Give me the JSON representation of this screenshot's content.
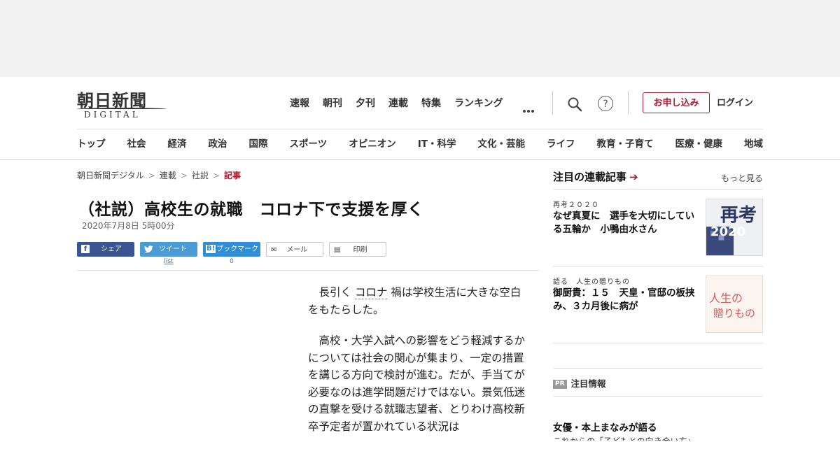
{
  "logo": {
    "name_jp": "朝日新聞",
    "name_en": "DIGITAL"
  },
  "topnav": [
    "速報",
    "朝刊",
    "夕刊",
    "連載",
    "特集",
    "ランキング"
  ],
  "header": {
    "apply_label": "お申し込み",
    "login_label": "ログイン",
    "help_glyph": "?"
  },
  "categories": [
    "トップ",
    "社会",
    "経済",
    "政治",
    "国際",
    "スポーツ",
    "オピニオン",
    "IT・科学",
    "文化・芸能",
    "ライフ",
    "教育・子育て",
    "医療・健康",
    "地域"
  ],
  "breadcrumb": [
    "朝日新聞デジタル",
    "連載",
    "社説",
    "記事"
  ],
  "article": {
    "headline": "（社説）高校生の就職　コロナ下で支援を厚く",
    "date": "2020年7月8日 5時00分",
    "p1_before": "長引く",
    "p1_keyword": "コロナ",
    "p1_after": "禍は学校生活に大きな空白をもたらした。",
    "p2": "高校・大学入試への影響をどう軽減するかについては社会の関心が集まり、一定の措置を講じる方向で検討が進む。だが、手当てが必要なのは進学問題だけではない。景気低迷の直撃を受ける就職志望者、とりわけ高校新卒予定者が置かれている状況は"
  },
  "share": {
    "facebook": "シェア",
    "twitter": "ツイート",
    "hatena": "ブックマーク",
    "mail": "メール",
    "print": "印刷",
    "twitter_count": "list",
    "hatena_count": "0"
  },
  "sidebar": {
    "heading": "注目の連載記事",
    "more": "もっと見る",
    "items": [
      {
        "tag": "再考２０２０",
        "title": "なぜ真夏に　選手を大切にしている五輪か　小鴨由水さん",
        "thumb_year": "2020",
        "thumb_word": "再考"
      },
      {
        "tag": "語る　人生の贈りもの",
        "title": "御厨貴：１５　天皇・官邸の板挟み、３カ月後に病が",
        "thumb_line1": "人生の",
        "thumb_line2": "贈りもの"
      }
    ],
    "pr_badge": "PR",
    "pr_label": "注目情報",
    "pr_title": "女優・本上まなみが語る",
    "pr_sub": "これからの「子どもとの向き合い方」"
  }
}
